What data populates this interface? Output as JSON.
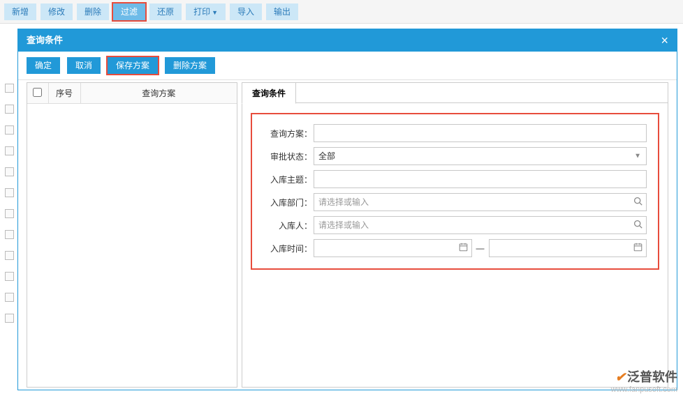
{
  "toolbar": {
    "new": "新增",
    "edit": "修改",
    "delete": "删除",
    "filter": "过滤",
    "restore": "还原",
    "print": "打印",
    "import": "导入",
    "export": "输出"
  },
  "dialog": {
    "title": "查询条件",
    "btn_ok": "确定",
    "btn_cancel": "取消",
    "btn_save_scheme": "保存方案",
    "btn_delete_scheme": "删除方案"
  },
  "scheme_table": {
    "col_seq": "序号",
    "col_scheme": "查询方案"
  },
  "query": {
    "tab_label": "查询条件",
    "scheme_label": "查询方案：",
    "approval_label": "审批状态：",
    "approval_value": "全部",
    "subject_label": "入库主题：",
    "dept_label": "入库部门：",
    "dept_placeholder": "请选择或输入",
    "person_label": "入库人：",
    "person_placeholder": "请选择或输入",
    "time_label": "入库时间：",
    "date_sep": "—"
  },
  "watermark": {
    "brand": "泛普软件",
    "url": "www.fanpusoft.com"
  }
}
